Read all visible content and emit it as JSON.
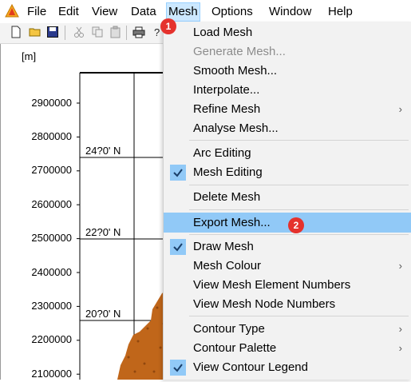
{
  "menubar": {
    "items": [
      "File",
      "Edit",
      "View",
      "Data",
      "Mesh",
      "Options",
      "Window",
      "Help"
    ]
  },
  "map": {
    "unit": "[m]",
    "y_ticks": [
      "2900000",
      "2800000",
      "2700000",
      "2600000",
      "2500000",
      "2400000",
      "2300000",
      "2200000",
      "2100000"
    ],
    "lat_labels": [
      "24?0' N",
      "22?0' N",
      "20?0' N"
    ]
  },
  "mesh_menu": {
    "load_mesh": "Load Mesh",
    "generate_mesh": "Generate Mesh...",
    "smooth_mesh": "Smooth Mesh...",
    "interpolate": "Interpolate...",
    "refine_mesh": "Refine Mesh",
    "analyse_mesh": "Analyse Mesh...",
    "arc_editing": "Arc Editing",
    "mesh_editing": "Mesh Editing",
    "delete_mesh": "Delete Mesh",
    "export_mesh": "Export Mesh...",
    "draw_mesh": "Draw Mesh",
    "mesh_colour": "Mesh Colour",
    "view_element_numbers": "View Mesh Element Numbers",
    "view_node_numbers": "View Mesh Node Numbers",
    "contour_type": "Contour Type",
    "contour_palette": "Contour Palette",
    "view_contour_legend": "View Contour Legend",
    "submenu_arrow": "›"
  },
  "badges": {
    "step1": "1",
    "step2": "2"
  },
  "colors": {
    "highlight": "#91c9f7",
    "active_menu": "#cce8ff",
    "badge": "#e5322d",
    "terrain": "#c0661a"
  },
  "icons": [
    "app-icon",
    "new-file-icon",
    "open-folder-icon",
    "save-icon",
    "cut-icon",
    "copy-icon",
    "paste-icon",
    "print-icon",
    "help-icon",
    "checkmark-icon",
    "chevron-right-icon"
  ]
}
